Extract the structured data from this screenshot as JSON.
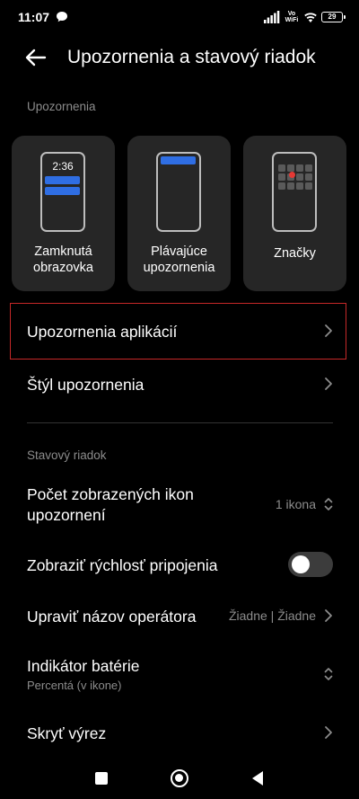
{
  "status_bar": {
    "time": "11:07",
    "network": "Vo WiFi",
    "battery": "29"
  },
  "header": {
    "title": "Upozornenia a stavový riadok"
  },
  "notifications_section": {
    "label": "Upozornenia",
    "cards": [
      {
        "label_line1": "Zamknutá",
        "label_line2": "obrazovka",
        "preview_time": "2:36"
      },
      {
        "label_line1": "Plávajúce",
        "label_line2": "upozornenia"
      },
      {
        "label_line1": "Značky",
        "label_line2": ""
      }
    ],
    "rows": [
      {
        "label": "Upozornenia aplikácií"
      },
      {
        "label": "Štýl upozornenia"
      }
    ]
  },
  "status_section": {
    "label": "Stavový riadok",
    "icon_count": {
      "label_line1": "Počet zobrazených ikon",
      "label_line2": "upozornení",
      "value": "1 ikona"
    },
    "speed": {
      "label": "Zobraziť rýchlosť pripojenia",
      "enabled": false
    },
    "carrier": {
      "label": "Upraviť názov operátora",
      "value": "Žiadne | Žiadne"
    },
    "battery": {
      "label": "Indikátor batérie",
      "subtitle": "Percentá (v ikone)"
    },
    "notch": {
      "label": "Skryť výrez"
    }
  },
  "icons": {
    "back": "arrow-left-icon",
    "chevron": "chevron-right-icon",
    "updown": "chevron-updown-icon",
    "nav_recents": "square-icon",
    "nav_home": "circle-icon",
    "nav_back": "triangle-icon"
  },
  "colors": {
    "accent_blue": "#2f6ee3",
    "badge_red": "#e53935",
    "highlight_red": "#c62828",
    "card_bg": "#262626"
  }
}
